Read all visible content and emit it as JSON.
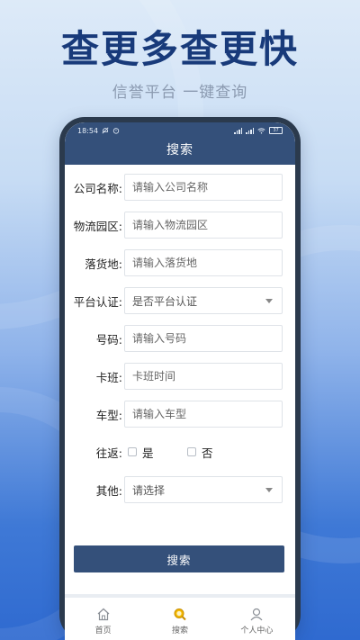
{
  "promo": {
    "headline": "查更多查更快",
    "subline": "信誉平台 一键查询"
  },
  "status_bar": {
    "time": "18:54",
    "battery": "37"
  },
  "app": {
    "title": "搜索"
  },
  "form": {
    "company": {
      "label": "公司名称:",
      "placeholder": "请输入公司名称"
    },
    "park": {
      "label": "物流园区:",
      "placeholder": "请输入物流园区"
    },
    "destination": {
      "label": "落货地:",
      "placeholder": "请输入落货地"
    },
    "certification": {
      "label": "平台认证:",
      "value": "是否平台认证"
    },
    "number": {
      "label": "号码:",
      "placeholder": "请输入号码"
    },
    "schedule": {
      "label": "卡班:",
      "placeholder": "卡班时间"
    },
    "vehicle": {
      "label": "车型:",
      "placeholder": "请输入车型"
    },
    "round_trip": {
      "label": "往返:",
      "yes": "是",
      "no": "否"
    },
    "other": {
      "label": "其他:",
      "value": "请选择"
    },
    "submit": "搜索"
  },
  "tabs": [
    {
      "label": "首页",
      "icon": "home-icon"
    },
    {
      "label": "搜索",
      "icon": "search-icon"
    },
    {
      "label": "个人中心",
      "icon": "person-icon"
    }
  ],
  "colors": {
    "header": "#34507a",
    "headline": "#183a7a",
    "active_tab_icon": "#e0a400"
  }
}
